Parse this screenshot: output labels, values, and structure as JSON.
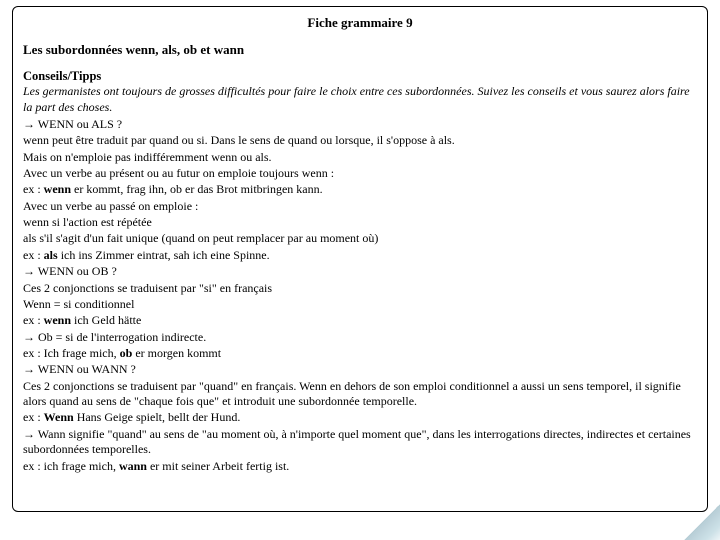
{
  "title": "Fiche grammaire 9",
  "subtitle": "Les subordonnées wenn, als, ob et wann",
  "section_head": "Conseils/Tipps",
  "intro": "Les germanistes ont toujours de grosses difficultés pour faire le choix entre ces subordonnées. Suivez les conseils et vous saurez alors faire la part des choses.",
  "lines": {
    "q1": "→ WENN ou ALS ?",
    "l1": "wenn peut être traduit par quand ou si. Dans le sens de quand ou lorsque, il s'oppose à als.",
    "l2": "Mais on n'emploie pas indifféremment wenn ou als.",
    "l3": "Avec un verbe au présent ou au futur on emploie toujours wenn :",
    "ex1a": "ex : ",
    "ex1b": "wenn",
    "ex1c": " er kommt, frag ihn, ob er das Brot mitbringen kann.",
    "l4": "Avec un verbe au passé on emploie :",
    "l5": "wenn si l'action est répétée",
    "l6": "als s'il s'agit d'un fait unique (quand on peut remplacer par au moment où)",
    "ex2a": "ex : ",
    "ex2b": "als",
    "ex2c": " ich ins Zimmer eintrat, sah ich eine Spinne.",
    "q2": "→ WENN ou OB ?",
    "l7": "Ces 2 conjonctions se traduisent par \"si\" en français",
    "l8": "Wenn = si conditionnel",
    "ex3a": "ex : ",
    "ex3b": "wenn",
    "ex3c": " ich Geld hätte",
    "l9": "→ Ob = si de l'interrogation indirecte.",
    "ex4a": "ex : Ich frage mich, ",
    "ex4b": "ob",
    "ex4c": " er morgen kommt",
    "q3": "→ WENN ou WANN ?",
    "l10": "Ces 2 conjonctions se traduisent par \"quand\" en français. Wenn en dehors de son emploi conditionnel a aussi un sens temporel, il signifie alors quand au sens de \"chaque fois que\" et introduit une subordonnée temporelle.",
    "ex5a": "ex : ",
    "ex5b": "Wenn",
    "ex5c": " Hans Geige spielt, bellt der Hund.",
    "l11": "→ Wann signifie \"quand\" au sens de \"au moment où, à n'importe quel moment que\", dans les interrogations directes, indirectes et certaines subordonnées temporelles.",
    "ex6a": "ex : ich frage mich, ",
    "ex6b": "wann",
    "ex6c": " er mit seiner Arbeit fertig ist."
  }
}
